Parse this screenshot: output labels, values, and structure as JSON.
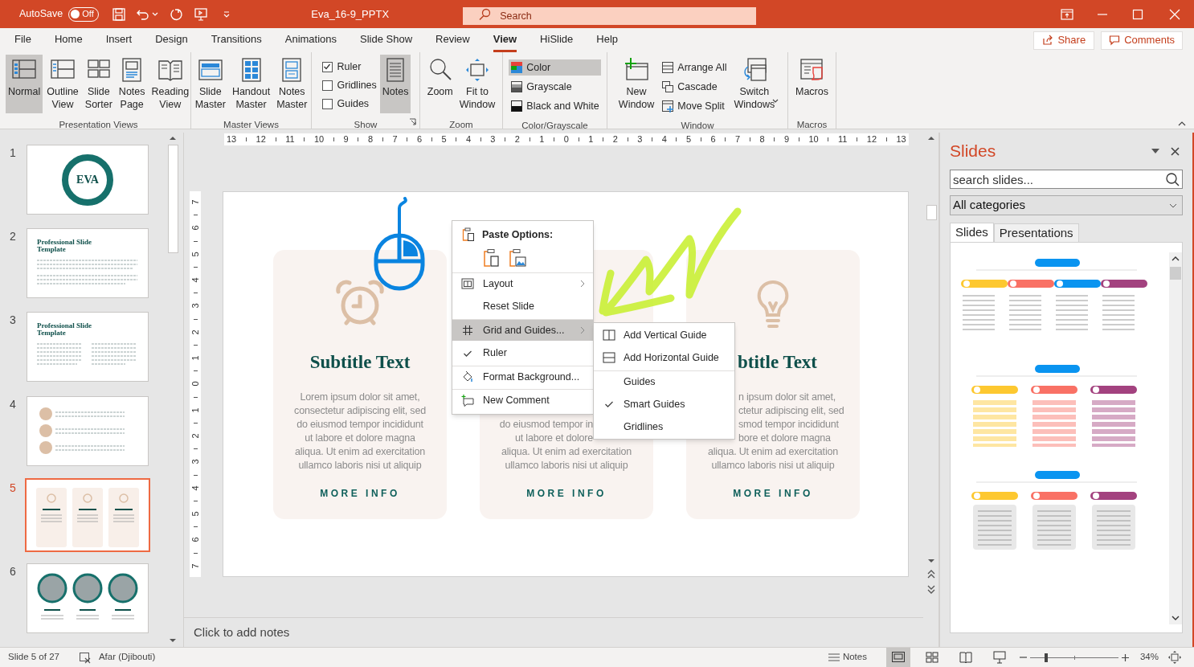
{
  "title_bar": {
    "autosave_label": "AutoSave",
    "autosave": {
      "on": false,
      "label": "Off"
    },
    "title": "Eva_16-9_PPTX",
    "search": {
      "placeholder": "Search"
    }
  },
  "ribbon_tabs": [
    {
      "label": "File",
      "selected": false
    },
    {
      "label": "Home",
      "selected": false
    },
    {
      "label": "Insert",
      "selected": false
    },
    {
      "label": "Design",
      "selected": false
    },
    {
      "label": "Transitions",
      "selected": false
    },
    {
      "label": "Animations",
      "selected": false
    },
    {
      "label": "Slide Show",
      "selected": false
    },
    {
      "label": "Review",
      "selected": false
    },
    {
      "label": "View",
      "selected": true
    },
    {
      "label": "HiSlide",
      "selected": false
    },
    {
      "label": "Help",
      "selected": false
    }
  ],
  "share_button": "Share",
  "comments_button": "Comments",
  "ribbon_groups": [
    {
      "name": "Presentation Views",
      "items": [
        {
          "kind": "large",
          "label": [
            "Normal"
          ],
          "selected": true,
          "dropdown": false
        },
        {
          "kind": "large",
          "label": [
            "Outline",
            "View"
          ],
          "selected": false,
          "dropdown": false
        },
        {
          "kind": "large",
          "label": [
            "Slide",
            "Sorter"
          ],
          "selected": false,
          "dropdown": false
        },
        {
          "kind": "large",
          "label": [
            "Notes",
            "Page"
          ],
          "selected": false,
          "dropdown": false
        },
        {
          "kind": "large",
          "label": [
            "Reading",
            "View"
          ],
          "selected": false,
          "dropdown": false
        }
      ]
    },
    {
      "name": "Master Views",
      "items": [
        {
          "kind": "large",
          "label": [
            "Slide",
            "Master"
          ],
          "selected": false,
          "dropdown": false
        },
        {
          "kind": "large",
          "label": [
            "Handout",
            "Master"
          ],
          "selected": false,
          "dropdown": false
        },
        {
          "kind": "large",
          "label": [
            "Notes",
            "Master"
          ],
          "selected": false,
          "dropdown": false
        }
      ]
    },
    {
      "name": "Show",
      "items": [
        {
          "kind": "check",
          "label": "Ruler",
          "checked": true
        },
        {
          "kind": "check",
          "label": "Gridlines",
          "checked": false
        },
        {
          "kind": "check",
          "label": "Guides",
          "checked": false
        },
        {
          "kind": "large",
          "label": [
            "Notes"
          ],
          "selected": true,
          "dropdown": false
        }
      ]
    },
    {
      "name": "Zoom",
      "items": [
        {
          "kind": "large",
          "label": [
            "Zoom"
          ],
          "selected": false,
          "dropdown": false
        },
        {
          "kind": "large",
          "label": [
            "Fit to",
            "Window"
          ],
          "selected": false,
          "dropdown": false
        }
      ]
    },
    {
      "name": "Color/Grayscale",
      "items": [
        {
          "kind": "small",
          "label": "Color",
          "selected": true
        },
        {
          "kind": "small",
          "label": "Grayscale",
          "selected": false
        },
        {
          "kind": "small",
          "label": "Black and White",
          "selected": false
        }
      ]
    },
    {
      "name": "Window",
      "items": [
        {
          "kind": "large",
          "label": [
            "New",
            "Window"
          ],
          "selected": false,
          "dropdown": false
        },
        {
          "kind": "small",
          "label": "Arrange All",
          "selected": false
        },
        {
          "kind": "small",
          "label": "Cascade",
          "selected": false
        },
        {
          "kind": "small",
          "label": "Move Split",
          "selected": false
        },
        {
          "kind": "large",
          "label": [
            "Switch",
            "Windows"
          ],
          "selected": false,
          "dropdown": true
        }
      ]
    },
    {
      "name": "Macros",
      "items": [
        {
          "kind": "large",
          "label": [
            "Macros"
          ],
          "selected": false,
          "dropdown": false
        }
      ]
    }
  ],
  "thumbnails": [
    {
      "number": "1",
      "kind": "title_ring",
      "title": "EVA",
      "selected": false
    },
    {
      "number": "2",
      "kind": "text_page",
      "title": "Professional Slide Template",
      "selected": false
    },
    {
      "number": "3",
      "kind": "two_column",
      "title": "Professional Slide Template",
      "selected": false
    },
    {
      "number": "4",
      "kind": "bullets",
      "selected": false
    },
    {
      "number": "5",
      "kind": "cards",
      "selected": true
    },
    {
      "number": "6",
      "kind": "circles",
      "selected": false
    }
  ],
  "ruler_horizontal": [
    "13",
    "12",
    "11",
    "10",
    "9",
    "8",
    "7",
    "6",
    "5",
    "4",
    "3",
    "2",
    "1",
    "0",
    "1",
    "2",
    "3",
    "4",
    "5",
    "6",
    "7",
    "8",
    "9",
    "10",
    "11",
    "12",
    "13"
  ],
  "ruler_vertical": [
    "7",
    "6",
    "5",
    "4",
    "3",
    "2",
    "1",
    "0",
    "1",
    "2",
    "3",
    "4",
    "5",
    "6",
    "7"
  ],
  "slide": {
    "cards": [
      {
        "title": {
          "text": "Subtitle Text",
          "kind": "full"
        },
        "lines": [
          {
            "text": "Lorem ipsum dolor sit amet,",
            "kind": "full"
          },
          {
            "text": "consectetur adipiscing elit, sed",
            "kind": "full"
          },
          {
            "text": "do eiusmod tempor incididunt",
            "kind": "full"
          },
          {
            "text": "ut labore et dolore magna",
            "kind": "full"
          },
          {
            "text": "aliqua. Ut enim ad exercitation",
            "kind": "full"
          },
          {
            "text": "ullamco laboris nisi ut aliquip",
            "kind": "full"
          }
        ],
        "link": "MORE INFO"
      },
      {
        "lines": [
          {
            "text": "do eiusmod tempor in",
            "kind": "clipped_right"
          },
          {
            "text": "ut labore et dolore",
            "kind": "clipped_right"
          },
          {
            "text": "aliqua. Ut enim ad exercitation",
            "kind": "full"
          },
          {
            "text": "ullamco laboris nisi ut aliquip",
            "kind": "full"
          }
        ],
        "link": "MORE INFO"
      },
      {
        "title": {
          "text": "btitle Text",
          "kind": "clipped_left"
        },
        "lines": [
          {
            "text": "n ipsum dolor sit amet,",
            "kind": "clipped_left"
          },
          {
            "text": "ctetur adipiscing elit, sed",
            "kind": "clipped_left"
          },
          {
            "text": "smod tempor incididunt",
            "kind": "clipped_left"
          },
          {
            "text": "bore et dolore magna",
            "kind": "clipped_left"
          },
          {
            "text": "aliqua. Ut enim ad exercitation",
            "kind": "full"
          },
          {
            "text": "ullamco laboris nisi ut aliquip",
            "kind": "full"
          }
        ],
        "link": "MORE INFO"
      }
    ]
  },
  "notes_placeholder": "Click to add notes",
  "context_menu": {
    "items": [
      {
        "kind": "header",
        "label": "Paste Options:",
        "separator_before": false
      },
      {
        "kind": "paste_icons",
        "separator_before": false
      },
      {
        "kind": "item",
        "label": "Layout",
        "submenu": true,
        "checked": false,
        "selected": false,
        "separator_before": true
      },
      {
        "kind": "item",
        "label": "Reset Slide",
        "submenu": false,
        "checked": false,
        "selected": false,
        "separator_before": false
      },
      {
        "kind": "item",
        "label": "Grid and Guides...",
        "submenu": true,
        "checked": false,
        "selected": true,
        "separator_before": true
      },
      {
        "kind": "item",
        "label": "Ruler",
        "submenu": false,
        "checked": true,
        "selected": false,
        "separator_before": false
      },
      {
        "kind": "item",
        "label": "Format Background...",
        "submenu": false,
        "checked": false,
        "selected": false,
        "separator_before": true
      },
      {
        "kind": "item",
        "label": "New Comment",
        "submenu": false,
        "checked": false,
        "selected": false,
        "separator_before": true
      }
    ]
  },
  "submenu": {
    "items": [
      {
        "label": "Add Vertical Guide",
        "checked": false,
        "separator_before": false
      },
      {
        "label": "Add Horizontal Guide",
        "checked": false,
        "separator_before": false
      },
      {
        "label": "Guides",
        "checked": false,
        "separator_before": true
      },
      {
        "label": "Smart Guides",
        "checked": true,
        "separator_before": false
      },
      {
        "label": "Gridlines",
        "checked": false,
        "separator_before": false
      }
    ]
  },
  "side_pane": {
    "title": "Slides",
    "search": {
      "placeholder": "search slides..."
    },
    "category": "All categories",
    "tabs": [
      {
        "label": "Slides",
        "selected": true
      },
      {
        "label": "Presentations",
        "selected": false
      }
    ]
  },
  "status_bar": {
    "slide_info": "Slide 5 of 27",
    "language": "Afar (Djibouti)",
    "notes_button": "Notes",
    "views": [
      {
        "selected": true
      },
      {
        "selected": false
      },
      {
        "selected": false
      },
      {
        "selected": false
      }
    ],
    "zoom": {
      "level": 0.18,
      "reading": "34%"
    }
  }
}
